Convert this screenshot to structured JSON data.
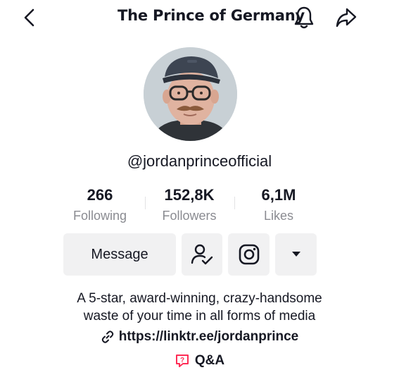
{
  "header": {
    "title": "The Prince of Germany",
    "back_icon": "chevron-left-icon",
    "bell_icon": "bell-icon",
    "share_icon": "share-arrow-icon"
  },
  "profile": {
    "username": "@jordanprinceofficial",
    "avatar": "profile-photo"
  },
  "stats": [
    {
      "value": "266",
      "label": "Following"
    },
    {
      "value": "152,8K",
      "label": "Followers"
    },
    {
      "value": "6,1M",
      "label": "Likes"
    }
  ],
  "actions": {
    "message_label": "Message",
    "following_icon": "user-check-icon",
    "instagram_icon": "instagram-icon",
    "more_icon": "caret-down-icon"
  },
  "bio": {
    "line1": "A 5-star, award-winning, crazy-handsome",
    "line2": "waste of your time in all forms of media"
  },
  "link": {
    "url": "https://linktr.ee/jordanprince",
    "icon": "link-icon"
  },
  "qa": {
    "label": "Q&A",
    "icon": "question-bubble-icon",
    "accent": "#fe2c55"
  },
  "colors": {
    "text": "#161823",
    "secondary": "#8a8b91",
    "button_bg": "#f1f1f2"
  }
}
